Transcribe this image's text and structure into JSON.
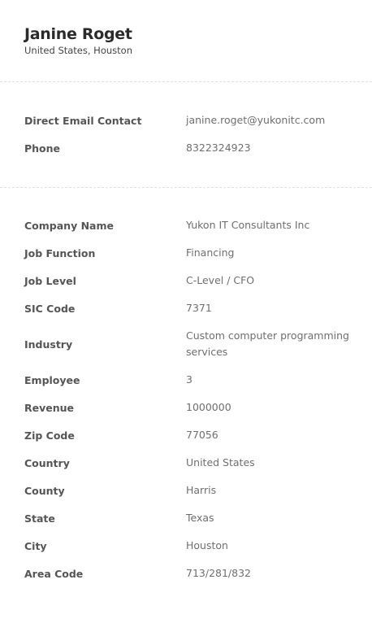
{
  "person": {
    "name": "Janine Roget",
    "location": "United States, Houston"
  },
  "contact": {
    "email_label": "Direct Email Contact",
    "email_value": "janine.roget@yukonitc.com",
    "phone_label": "Phone",
    "phone_value": "8322324923"
  },
  "details": {
    "company_label": "Company Name",
    "company_value": "Yukon IT Consultants Inc",
    "job_function_label": "Job Function",
    "job_function_value": "Financing",
    "job_level_label": "Job Level",
    "job_level_value": "C-Level / CFO",
    "sic_label": "SIC Code",
    "sic_value": "7371",
    "industry_label": "Industry",
    "industry_value": "Custom computer programming services",
    "employee_label": "Employee",
    "employee_value": "3",
    "revenue_label": "Revenue",
    "revenue_value": "1000000",
    "zip_label": "Zip Code",
    "zip_value": "77056",
    "country_label": "Country",
    "country_value": "United States",
    "county_label": "County",
    "county_value": "Harris",
    "state_label": "State",
    "state_value": "Texas",
    "city_label": "City",
    "city_value": "Houston",
    "area_code_label": "Area Code",
    "area_code_value": "713/281/832"
  }
}
